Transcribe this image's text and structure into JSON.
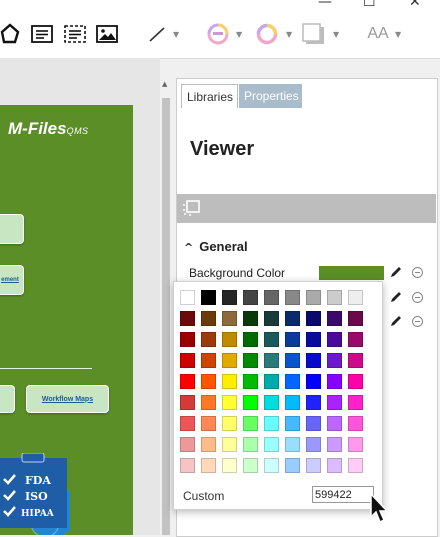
{
  "window": {
    "minimize": "—",
    "maximize": "☐",
    "close": "✕"
  },
  "toolbar": {
    "icons": [
      "pentagon-icon",
      "textbox-icon",
      "dashed-textbox-icon",
      "image-icon",
      "line-icon",
      "fill-color-icon",
      "stroke-color-icon",
      "shadow-icon",
      "font-size-icon"
    ],
    "font_size_label": "AA"
  },
  "canvas": {
    "logo_main": "M-Files",
    "logo_sub": "QMS",
    "box_ement": "ement",
    "box_workflow": "Workflow Maps",
    "badges": [
      "FDA",
      "ISO",
      "HIPAA"
    ]
  },
  "panel": {
    "tabs": [
      "Libraries",
      "Properties"
    ],
    "title": "Viewer",
    "section": "General",
    "section_toggle": "^",
    "row_label": "Background Color",
    "bg_color": "#5b8e27"
  },
  "picker": {
    "custom_label": "Custom",
    "custom_value": "599422",
    "colors": [
      "#ffffff",
      "#000000",
      "#262626",
      "#444444",
      "#666666",
      "#888888",
      "#aaaaaa",
      "#cccccc",
      "#eeeeee",
      "#6b0a0a",
      "#6b3a0a",
      "#8c6a3a",
      "#0a3a0a",
      "#1a3a3a",
      "#0a2a6b",
      "#0a0a6b",
      "#3a0a6b",
      "#6b0a4a",
      "#9b0000",
      "#9b3a0a",
      "#c08a00",
      "#006b00",
      "#1a5a5a",
      "#0a3a9b",
      "#0a0a9b",
      "#4a0a9b",
      "#9b0a6b",
      "#cc0000",
      "#cc4400",
      "#e0aa00",
      "#008a00",
      "#2a7a7a",
      "#0a55cc",
      "#0a0acc",
      "#6a1acc",
      "#cc0a8a",
      "#ff0000",
      "#ff5500",
      "#ffee00",
      "#00bb00",
      "#00aaaa",
      "#0066ff",
      "#0000ff",
      "#8800ff",
      "#ff00aa",
      "#d43a3a",
      "#ff7722",
      "#ffff33",
      "#00ff00",
      "#00dddd",
      "#00bbff",
      "#2222ff",
      "#aa22ff",
      "#ff22cc",
      "#ee5555",
      "#ff8855",
      "#ffff66",
      "#66ff66",
      "#66ffff",
      "#44bbff",
      "#6666ff",
      "#bb66ff",
      "#ff55dd",
      "#ee9999",
      "#ffbb88",
      "#ffff99",
      "#aaffaa",
      "#99ffff",
      "#99ddff",
      "#9999ff",
      "#cc99ff",
      "#ff99ee",
      "#f5c5c5",
      "#ffd9bb",
      "#ffffcc",
      "#ccffcc",
      "#ccffff",
      "#99ccff",
      "#ccccff",
      "#ddbbff",
      "#ffccf5"
    ]
  }
}
